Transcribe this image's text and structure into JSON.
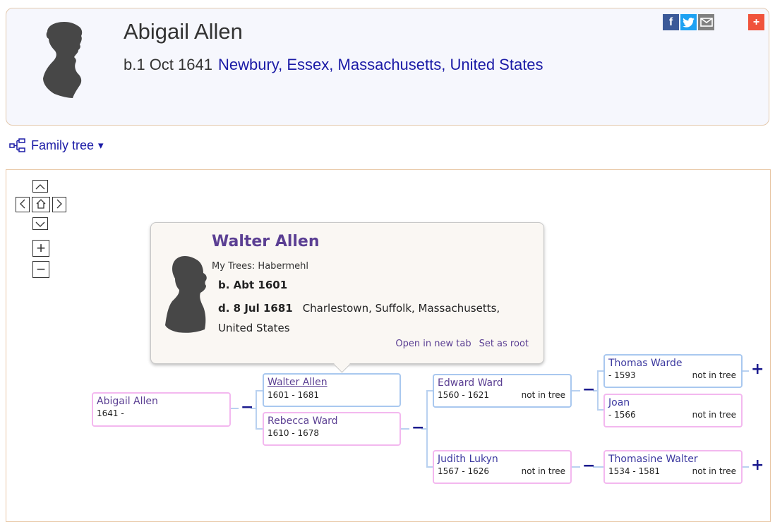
{
  "profile": {
    "name": "Abigail Allen",
    "birth_label": "b.1 Oct 1641",
    "birth_place": "Newbury, Essex, Massachusetts, United States",
    "silhouette_icon": "female-silhouette-icon"
  },
  "share": {
    "facebook": "f",
    "twitter": "t",
    "email": "✉",
    "more": "+"
  },
  "family_tree_link": {
    "label": "Family tree",
    "caret": "▾"
  },
  "tree_nav": {
    "up": "⌃",
    "left": "<",
    "home": "⌂",
    "right": ">",
    "down": "⌄",
    "zoom_in": "+",
    "zoom_out": "−"
  },
  "popup": {
    "name": "Walter Allen",
    "trees": "My Trees: Habermehl",
    "birth": "b. Abt 1601",
    "death_date": "d. 8 Jul 1681",
    "death_place": "Charlestown, Suffolk, Massachusetts, United States",
    "open_new_tab": "Open in new tab",
    "set_as_root": "Set as root"
  },
  "tree": {
    "people": [
      {
        "id": "abigail",
        "name": "Abigail Allen",
        "dates": "1641 -",
        "status": "",
        "gender": "female"
      },
      {
        "id": "walter",
        "name": "Walter Allen",
        "dates": "1601 - 1681",
        "status": "",
        "gender": "male"
      },
      {
        "id": "rebecca",
        "name": "Rebecca Ward",
        "dates": "1610 - 1678",
        "status": "",
        "gender": "female"
      },
      {
        "id": "edward",
        "name": "Edward Ward",
        "dates": "1560 - 1621",
        "status": "not in tree",
        "gender": "male"
      },
      {
        "id": "judith",
        "name": "Judith Lukyn",
        "dates": "1567 - 1626",
        "status": "not in tree",
        "gender": "female"
      },
      {
        "id": "thomas",
        "name": "Thomas Warde",
        "dates": "- 1593",
        "status": "not in tree",
        "gender": "male"
      },
      {
        "id": "joan",
        "name": "Joan",
        "dates": "- 1566",
        "status": "not in tree",
        "gender": "female"
      },
      {
        "id": "thomasine",
        "name": "Thomasine Walter",
        "dates": "1534 - 1581",
        "status": "not in tree",
        "gender": "female"
      }
    ],
    "collapse_symbol": "−",
    "expand_symbol": "+"
  },
  "colors": {
    "link": "#1a1aa6",
    "name_purple": "#5b3f93",
    "male_border": "#a9c8ef",
    "female_border": "#f3b8ef"
  }
}
